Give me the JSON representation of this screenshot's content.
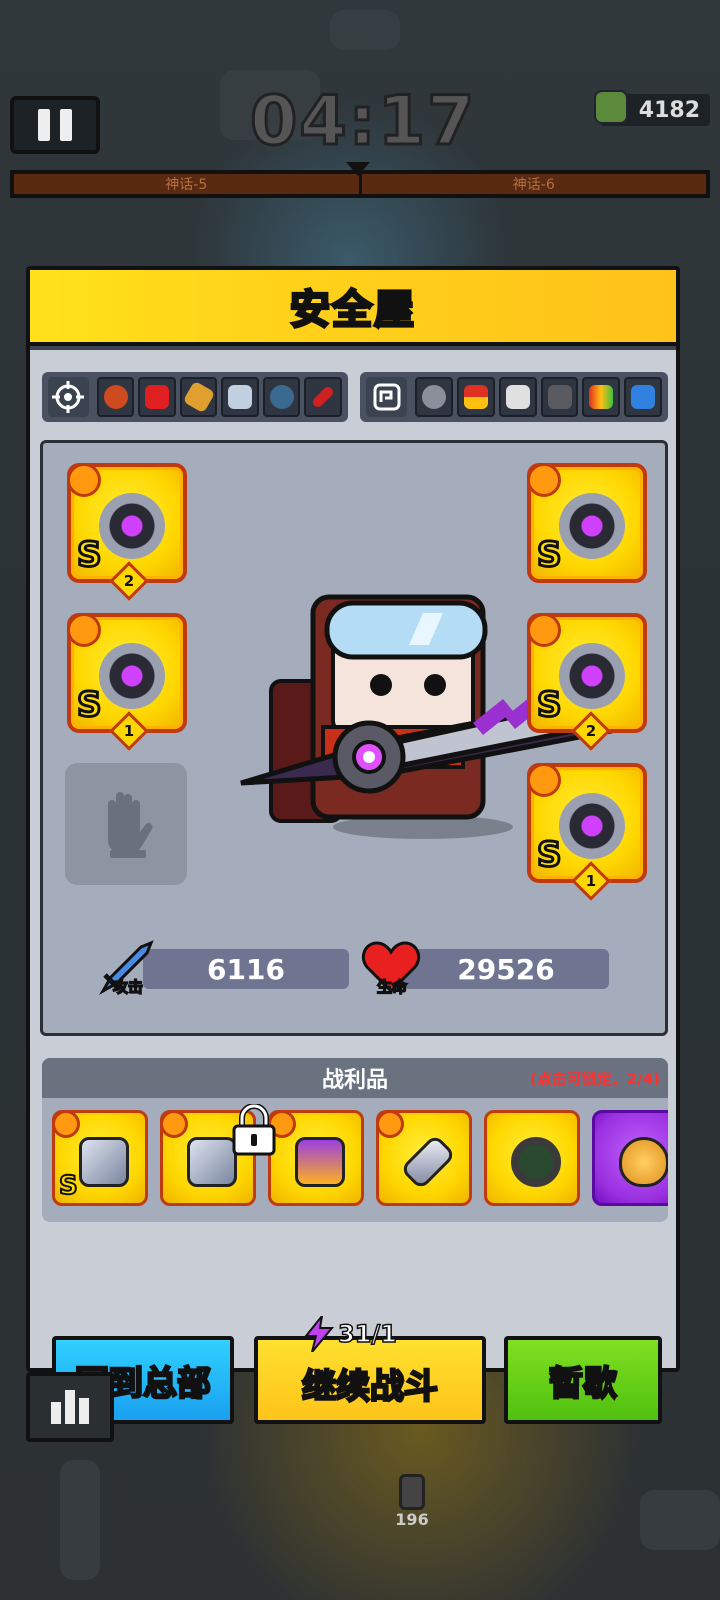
{
  "hud": {
    "timer": "04:17",
    "kill_count": "4182",
    "stage_left": "神话-5",
    "stage_right": "神话-6",
    "bottom_unit_count": "196"
  },
  "modal": {
    "title": "安全屋",
    "weapon_slots": [
      "fire-wheel",
      "fuel-can",
      "cylinder",
      "drone",
      "eye-orb",
      "blade"
    ],
    "support_slots": [
      "mine",
      "battery",
      "sneaker",
      "vest",
      "chip",
      "bottle"
    ],
    "equipment": {
      "left": [
        {
          "name": "weapon-shuriken-sword",
          "type": "weapon",
          "grade": "S",
          "level": "2"
        },
        {
          "name": "necklace",
          "type": "necklace",
          "grade": "S",
          "level": "1"
        }
      ],
      "gloves_empty": true,
      "right": [
        {
          "name": "armor",
          "type": "armor",
          "grade": "S"
        },
        {
          "name": "belt",
          "type": "belt",
          "grade": "S",
          "level": "2"
        },
        {
          "name": "boots",
          "type": "boots",
          "grade": "S",
          "level": "1"
        }
      ]
    },
    "stats": {
      "attack_label": "攻击",
      "attack_value": "6116",
      "hp_label": "生命",
      "hp_value": "29526"
    },
    "loot": {
      "title": "战利品",
      "hint": "(点击可锁定，2/4)",
      "items": [
        {
          "name": "loot-gauntlet",
          "grade": "S",
          "rarity": "gold"
        },
        {
          "name": "loot-gauntlet-locked",
          "grade": "",
          "rarity": "gold",
          "locked": true
        },
        {
          "name": "loot-lantern-necklace",
          "grade": "",
          "rarity": "gold"
        },
        {
          "name": "loot-kunai",
          "grade": "",
          "rarity": "gold"
        },
        {
          "name": "loot-green-ring",
          "grade": "",
          "rarity": "gold"
        },
        {
          "name": "loot-egg",
          "grade": "",
          "rarity": "purple"
        }
      ]
    },
    "buttons": {
      "home": "回到总部",
      "continue": "继续战斗",
      "rest": "暂歇",
      "energy": "31/1"
    }
  },
  "colors": {
    "header_yellow": "#ffd21a",
    "gold_card": "#ffd700",
    "home_blue": "#1aa0f0",
    "continue_yellow": "#ffc41a",
    "rest_green": "#50c010",
    "hint_red": "#ff3030"
  }
}
